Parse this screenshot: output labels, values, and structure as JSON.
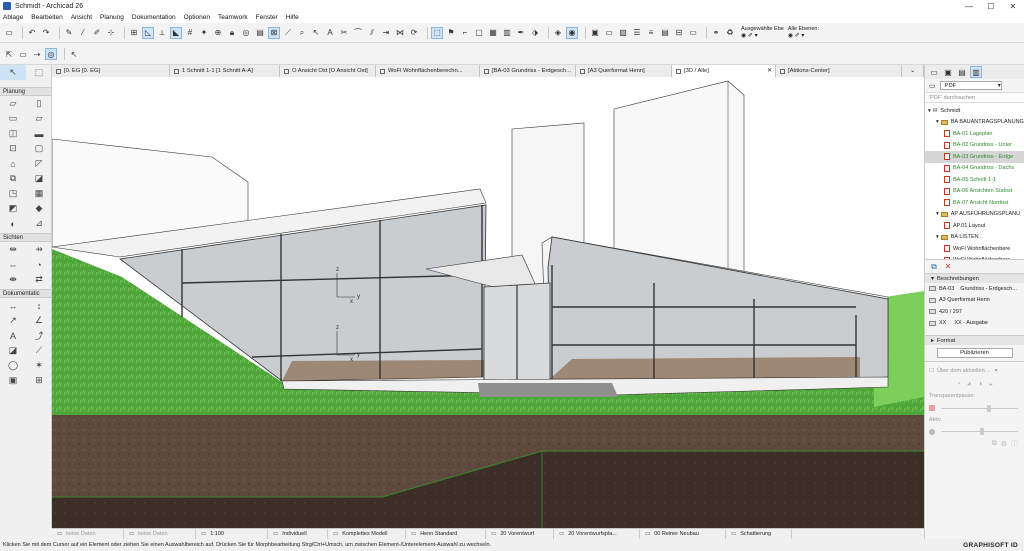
{
  "window": {
    "title": "Schmidt - Archicad 26",
    "min": "—",
    "max": "☐",
    "close": "✕"
  },
  "menu": [
    "Ablage",
    "Bearbeiten",
    "Ansicht",
    "Planung",
    "Dokumentation",
    "Optionen",
    "Teamwork",
    "Fenster",
    "Hilfe"
  ],
  "toolbar": {
    "selected_label": "Ausgewählte Ebe",
    "all_levels_label": "Alle Ebenen:"
  },
  "tabs": [
    {
      "label": "[0. EG [0. EG]"
    },
    {
      "label": "1 Schnitt 1-1 [1 Schnitt A-A]"
    },
    {
      "label": "O Ansicht Ost [O Ansicht Ost]"
    },
    {
      "label": "WoFl Wohnflächenberechn..."
    },
    {
      "label": "[BA-03 Grundriss - Erdgesch..."
    },
    {
      "label": "[A3 Querformat Henn]"
    },
    {
      "label": "[3D / Alle]"
    },
    {
      "label": "[Aktions-Center]"
    }
  ],
  "toolbox": {
    "planung": "Planung",
    "sichten": "Sichten",
    "dokumentation": "Dokumentatic"
  },
  "navigator": {
    "dropdown": "PDF",
    "search_placeholder": "'PDF' durchsuchen",
    "root": "Schmidt",
    "items": [
      {
        "label": "BA BAUANTRAGSPLANUNG",
        "kind": "folder",
        "indent": 1
      },
      {
        "label": "BA-01 Lageplan",
        "kind": "layout",
        "indent": 2,
        "green": true
      },
      {
        "label": "BA-02 Grundriss - Unter",
        "kind": "layout",
        "indent": 2,
        "green": true
      },
      {
        "label": "BA-03 Grundriss - Erdge",
        "kind": "layout",
        "indent": 2,
        "green": true,
        "selected": true
      },
      {
        "label": "BA-04 Grundriss - Dachs",
        "kind": "layout",
        "indent": 2,
        "green": true
      },
      {
        "label": "BA-05 Schnitt 1-1",
        "kind": "layout",
        "indent": 2,
        "green": true
      },
      {
        "label": "BA-06 Ansichten Südost",
        "kind": "layout",
        "indent": 2,
        "green": true
      },
      {
        "label": "BA-07 Ansicht Nordost",
        "kind": "layout",
        "indent": 2,
        "green": true
      },
      {
        "label": "AP AUSFÜHRUNGSPLANU",
        "kind": "folder",
        "indent": 1
      },
      {
        "label": "AP.01 Layout",
        "kind": "layout",
        "indent": 2
      },
      {
        "label": "BA LISTEN",
        "kind": "folder",
        "indent": 1
      },
      {
        "label": "WoFl Wohnflächenbere",
        "kind": "layout",
        "indent": 2
      },
      {
        "label": "WoFl Wohnflächenbere",
        "kind": "layout",
        "indent": 2
      }
    ],
    "descriptions_head": "Beschreibungen",
    "desc_id": "BA-03",
    "desc_name": "Grundriss - Erdgesch...",
    "desc_format": "A3 Querformat Henn",
    "desc_size": "420 / 297",
    "desc_xx1": "XX",
    "desc_xx2": "XX - Ausgabe",
    "format_head": "Format",
    "publish": "Publizieren",
    "above_current": "Über dem aktuellen ...",
    "transparency": "Transparentpause:",
    "active": "Aktiv"
  },
  "statusbar": [
    {
      "label": "keine Daten",
      "grey": true,
      "w": 72
    },
    {
      "label": "keine Daten",
      "grey": true,
      "w": 72
    },
    {
      "label": "1:100",
      "w": 72
    },
    {
      "label": "Individuell",
      "w": 60
    },
    {
      "label": "Komplettes Modell",
      "w": 78
    },
    {
      "label": "Henn Standard",
      "w": 80
    },
    {
      "label": "20 Vorentwurf",
      "w": 68
    },
    {
      "label": "20 Vorentwurfspla...",
      "w": 86
    },
    {
      "label": "00 Reiner Neubau",
      "w": 86
    },
    {
      "label": "Schattierung",
      "w": 66
    }
  ],
  "hint": "Klicken Sie mit dem Cursor auf ein Element oder ziehen Sie einen Auswahlbereich auf. Drücken Sie für Morphbearbeitung Strg/Ctrl+Umsch, um zwischen Element-/Unterelement-Auswahl zu wechseln.",
  "brand": "GRAPHISOFT ID",
  "axis": {
    "z": "z",
    "x": "x",
    "y": "y"
  }
}
